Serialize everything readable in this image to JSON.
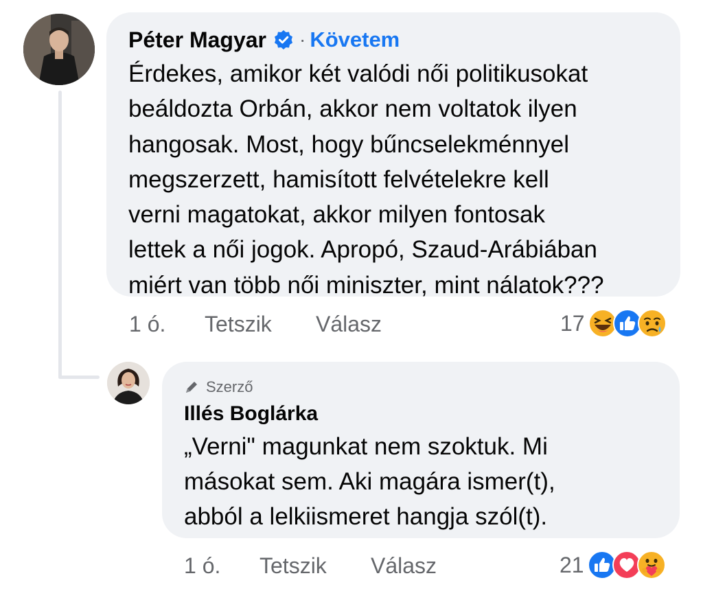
{
  "comment": {
    "author": "Péter Magyar",
    "separator": "·",
    "follow_label": "Követem",
    "lines": [
      "Érdekes, amikor két valódi női politikusokat",
      "beáldozta Orbán, akkor nem voltatok ilyen",
      "hangosak. Most, hogy bűncselekménnyel",
      "megszerzett, hamisított felvételekre kell",
      "verni magatokat, akkor milyen fontosak",
      "lettek a női jogok. Apropó, Szaud-Arábiában",
      "miért van több női miniszter, mint nálatok???"
    ],
    "time": "1 ó.",
    "like_label": "Tetszik",
    "reply_label": "Válasz",
    "reaction_count": "17",
    "reaction_icons": [
      "haha-icon",
      "like-icon",
      "sad-icon"
    ]
  },
  "reply": {
    "badge": "Szerző",
    "author": "Illés Boglárka",
    "lines": [
      "„Verni\" magunkat nem szoktuk. Mi",
      "másokat sem. Aki magára ismer(t),",
      "abból a lelkiismeret hangja szól(t)."
    ],
    "time": "1 ó.",
    "like_label": "Tetszik",
    "reply_label": "Válasz",
    "reaction_count": "21",
    "reaction_icons": [
      "like-icon",
      "love-icon",
      "care-icon"
    ]
  },
  "colors": {
    "bubble_bg": "#f0f2f5",
    "link_blue": "#1877f2",
    "meta_gray": "#65676b",
    "text": "#050505"
  }
}
